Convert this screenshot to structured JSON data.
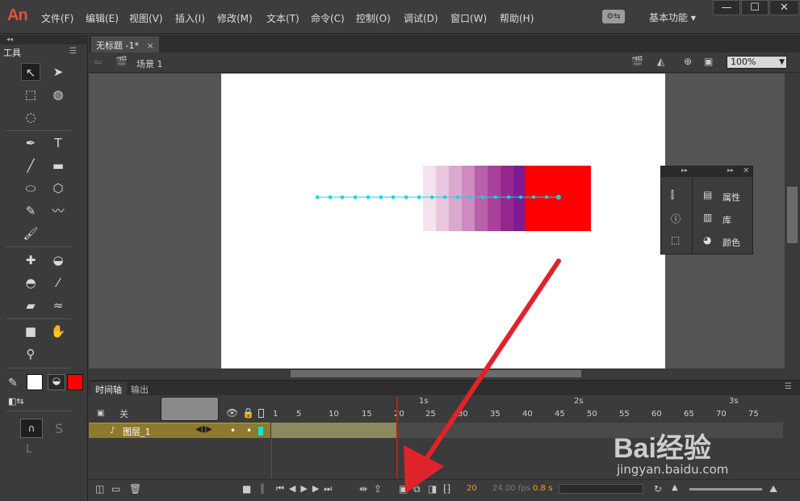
{
  "app": {
    "logo": "An"
  },
  "menu": [
    "文件(F)",
    "编辑(E)",
    "视图(V)",
    "插入(I)",
    "修改(M)",
    "文本(T)",
    "命令(C)",
    "控制(O)",
    "调试(D)",
    "窗口(W)",
    "帮助(H)"
  ],
  "workspace": {
    "label": "基本功能 ▾"
  },
  "window_buttons": [
    "—",
    "☐",
    "✕"
  ],
  "tools_panel": {
    "header": "◂◂",
    "tab": "工具"
  },
  "document": {
    "tab_title": "无标题 -1*",
    "close": "×",
    "scene_label": "场景 1",
    "zoom": "100%"
  },
  "float_panel": {
    "items": [
      "属性",
      "库",
      "颜色"
    ]
  },
  "timeline": {
    "tabs": [
      "时间轴",
      "输出"
    ],
    "layer_header": "关",
    "layer_name": "图层_1",
    "frame_labels": [
      "1",
      "5",
      "10",
      "15",
      "20",
      "25",
      "30",
      "35",
      "40",
      "45",
      "50",
      "55",
      "60",
      "65",
      "70",
      "75"
    ],
    "second_labels": [
      "1s",
      "2s",
      "3s"
    ],
    "current_frame": "20",
    "fps": "24.00 fps",
    "time": "0.8 s"
  },
  "watermark": {
    "brand": "Bai经验",
    "url": "jingyan.baidu.com"
  },
  "colors": {
    "stroke": "#ffffff",
    "fill": "#ff0000",
    "stage_rect": "#ff0000",
    "motion_path": "#00e5e5",
    "accent_red": "#e0222a"
  }
}
